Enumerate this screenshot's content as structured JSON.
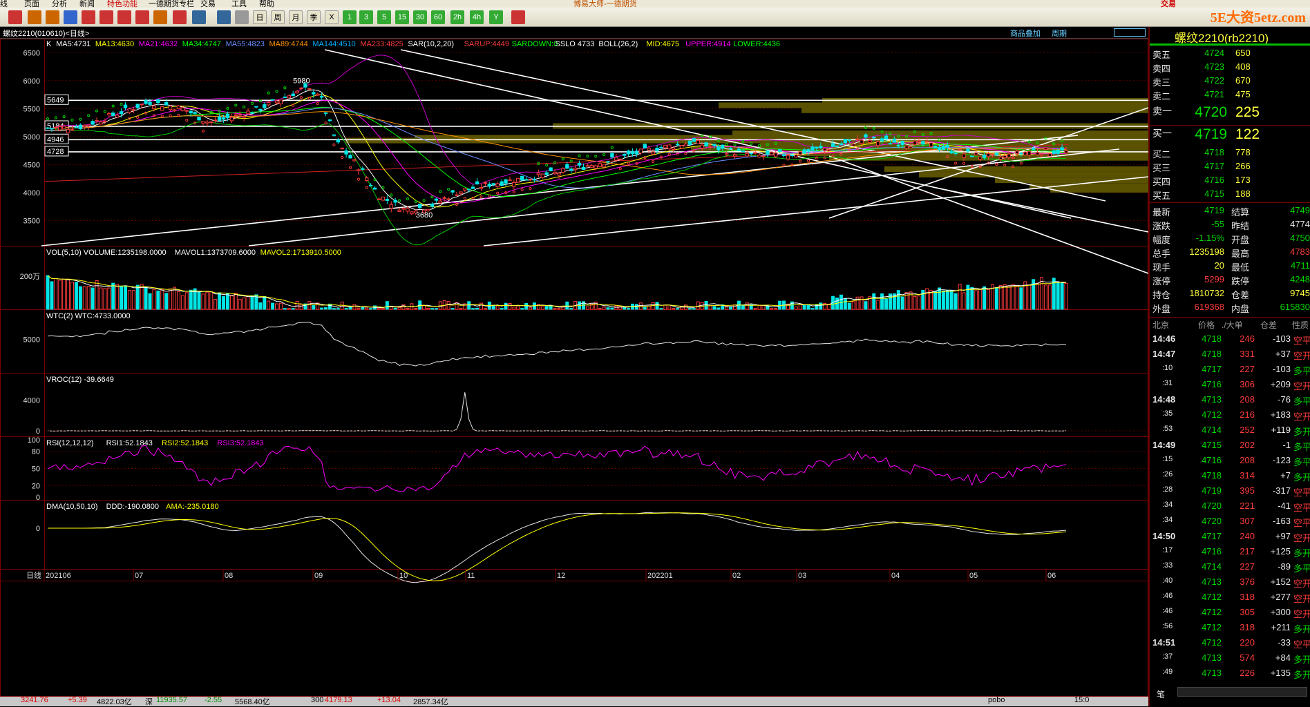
{
  "menu": [
    "线",
    "页面",
    "分析",
    "新闻",
    "特色功能",
    "一德期货专栏",
    "交易",
    "工具",
    "帮助"
  ],
  "title_center": "博易大师-一德期货",
  "trade_btn": "交易",
  "logo": "5E大资5etz.com",
  "toolbar_icons": [
    "home-icon",
    "back-icon",
    "forward-icon",
    "refresh-icon",
    "zoom-in-icon",
    "zoom-out-icon",
    "search-icon",
    "draw-pencil-icon",
    "indicator-icon",
    "filter-icon",
    "list-icon",
    "grid-table-icon",
    "tick-icon",
    "day-icon",
    "week-icon",
    "month-icon",
    "quarter-icon",
    "x-icon",
    "1min-icon",
    "3min-icon",
    "5min-icon",
    "15min-icon",
    "30min-icon",
    "60min-icon",
    "2h-icon",
    "4h-icon",
    "year-icon",
    "calculator-icon"
  ],
  "toolbar_labels": [
    "",
    "",
    "",
    "",
    "",
    "",
    "",
    "",
    "",
    "",
    "",
    "",
    "",
    "日",
    "周",
    "月",
    "季",
    "X",
    "1",
    "3",
    "5",
    "15",
    "30",
    "60",
    "2h",
    "4h",
    "Y",
    ""
  ],
  "chart_header": {
    "symbol_title": "螺纹2210(010610)<日线>",
    "overlay": "商品叠加",
    "cycle": "周期"
  },
  "main_indicators": [
    {
      "text": "K",
      "color": "#ffffff"
    },
    {
      "text": "MA5:4731",
      "color": "#ffffff"
    },
    {
      "text": "MA13:4630",
      "color": "#ffff00"
    },
    {
      "text": "MA21:4632",
      "color": "#ff00ff"
    },
    {
      "text": "MA34:4747",
      "color": "#00ff00"
    },
    {
      "text": "MA55:4823",
      "color": "#6c8cff"
    },
    {
      "text": "MA89:4744",
      "color": "#ff9000"
    },
    {
      "text": "MA144:4510",
      "color": "#00b0ff"
    },
    {
      "text": "MA233:4825",
      "color": "#ff3c3c"
    },
    {
      "text": "SAR(10,2,20)",
      "color": "#ffffff"
    },
    {
      "text": "SARUP:4449",
      "color": "#ff3c3c"
    },
    {
      "text": "SARDOWN:0",
      "color": "#00ff00"
    },
    {
      "text": "SSLO 4733",
      "color": "#ffffff"
    },
    {
      "text": "BOLL(26,2)",
      "color": "#ffffff"
    },
    {
      "text": "MID:4675",
      "color": "#ffff00"
    },
    {
      "text": "UPPER:4914",
      "color": "#ff00ff"
    },
    {
      "text": "LOWER:4436",
      "color": "#00ff00"
    }
  ],
  "price_axis": [
    "6500",
    "6000",
    "5500",
    "5000",
    "4500",
    "4000",
    "3500"
  ],
  "level_boxes": [
    "5649",
    "5184",
    "4946",
    "4728"
  ],
  "price_notes": {
    "high": "5980",
    "low": "3680"
  },
  "vol_header": [
    {
      "text": "VOL(5,10) VOLUME:1235198.0000",
      "color": "#ffffff"
    },
    {
      "text": "MAVOL1:1373709.6000",
      "color": "#ffffff"
    },
    {
      "text": "MAVOL2:1713910.5000",
      "color": "#ffff00"
    }
  ],
  "vol_axis": "200万",
  "wtc_header": "WTC(2) WTC:4733.0000",
  "wtc_axis": "5000",
  "vroc_header": "VROC(12) -39.6649",
  "vroc_axis": [
    "4000",
    "0"
  ],
  "rsi_header": [
    {
      "text": "RSI(12,12,12)",
      "color": "#ffffff"
    },
    {
      "text": "RSI1:52.1843",
      "color": "#ffffff"
    },
    {
      "text": "RSI2:52.1843",
      "color": "#ffff00"
    },
    {
      "text": "RSI3:52.1843",
      "color": "#ff00ff"
    }
  ],
  "rsi_axis": [
    "100",
    "80",
    "50",
    "20",
    "0"
  ],
  "dma_header": [
    {
      "text": "DMA(10,50,10)",
      "color": "#ffffff"
    },
    {
      "text": "DDD:-190.0800",
      "color": "#ffffff"
    },
    {
      "text": "AMA:-235.0180",
      "color": "#ffff00"
    }
  ],
  "dma_axis": "0",
  "date_axis": [
    "日线",
    "202106",
    "07",
    "08",
    "09",
    "10",
    "11",
    "12",
    "202201",
    "02",
    "03",
    "04",
    "05",
    "06"
  ],
  "quote": {
    "title": "螺纹2210(rb2210)",
    "asks": [
      [
        "卖五",
        "4724",
        "650"
      ],
      [
        "卖四",
        "4723",
        "408"
      ],
      [
        "卖三",
        "4722",
        "670"
      ],
      [
        "卖二",
        "4721",
        "475"
      ]
    ],
    "ask1": [
      "卖一",
      "4720",
      "225"
    ],
    "bid1": [
      "买一",
      "4719",
      "122"
    ],
    "bids": [
      [
        "买二",
        "4718",
        "778"
      ],
      [
        "买三",
        "4717",
        "266"
      ],
      [
        "买四",
        "4716",
        "173"
      ],
      [
        "买五",
        "4715",
        "188"
      ]
    ],
    "stats": [
      [
        "最新",
        "4719",
        "结算",
        "4749"
      ],
      [
        "涨跌",
        "-55",
        "昨结",
        "4774"
      ],
      [
        "幅度",
        "-1.15%",
        "开盘",
        "4750"
      ],
      [
        "总手",
        "1235198",
        "最高",
        "4783"
      ],
      [
        "现手",
        "20",
        "最低",
        "4711"
      ],
      [
        "涨停",
        "5299",
        "跌停",
        "4248"
      ],
      [
        "持仓",
        "1810732",
        "仓差",
        "9745"
      ],
      [
        "外盘",
        "619368",
        "内盘",
        "615830"
      ]
    ],
    "tick_header": [
      "北京",
      "价格",
      "./大单",
      "仓差",
      "性质"
    ],
    "ticks": [
      [
        "14:46",
        "4718",
        "246",
        "-103",
        "空平"
      ],
      [
        "14:47",
        "4718",
        "331",
        "+37",
        "空开"
      ],
      [
        ":10",
        "4717",
        "227",
        "-103",
        "多平"
      ],
      [
        ":31",
        "4716",
        "306",
        "+209",
        "空开"
      ],
      [
        "14:48",
        "4713",
        "208",
        "-76",
        "多平"
      ],
      [
        ":35",
        "4712",
        "216",
        "+183",
        "空开"
      ],
      [
        ":53",
        "4714",
        "252",
        "+119",
        "多开"
      ],
      [
        "14:49",
        "4715",
        "202",
        "-1",
        "多平"
      ],
      [
        ":15",
        "4716",
        "208",
        "-123",
        "多平"
      ],
      [
        ":26",
        "4718",
        "314",
        "+7",
        "多开"
      ],
      [
        ":28",
        "4719",
        "395",
        "-317",
        "空平"
      ],
      [
        ":34",
        "4720",
        "221",
        "-41",
        "空平"
      ],
      [
        ":34",
        "4720",
        "307",
        "-163",
        "空平"
      ],
      [
        "14:50",
        "4717",
        "240",
        "+97",
        "空开"
      ],
      [
        ":17",
        "4716",
        "217",
        "+125",
        "多开"
      ],
      [
        ":33",
        "4714",
        "227",
        "-89",
        "多平"
      ],
      [
        ":40",
        "4713",
        "376",
        "+152",
        "空开"
      ],
      [
        ":46",
        "4712",
        "318",
        "+277",
        "空开"
      ],
      [
        ":46",
        "4712",
        "305",
        "+300",
        "空开"
      ],
      [
        ":56",
        "4712",
        "318",
        "+211",
        "多开"
      ],
      [
        "14:51",
        "4712",
        "220",
        "-33",
        "空平"
      ],
      [
        ":37",
        "4713",
        "574",
        "+84",
        "多开"
      ],
      [
        ":49",
        "4713",
        "226",
        "+135",
        "多开"
      ]
    ],
    "bottom_tab": "笔"
  },
  "status_bar": [
    "3241.76",
    "+5.39",
    "4822.03亿",
    "深",
    "11935.57",
    "-2.55",
    "5568.40亿",
    "300",
    "4179.13",
    "+13.04",
    "2857.34亿",
    "pobo",
    "15:0"
  ],
  "colors": {
    "up": "#ff3c3c",
    "down": "#00e5e5",
    "grid": "#7a0000",
    "bg": "#000000"
  }
}
